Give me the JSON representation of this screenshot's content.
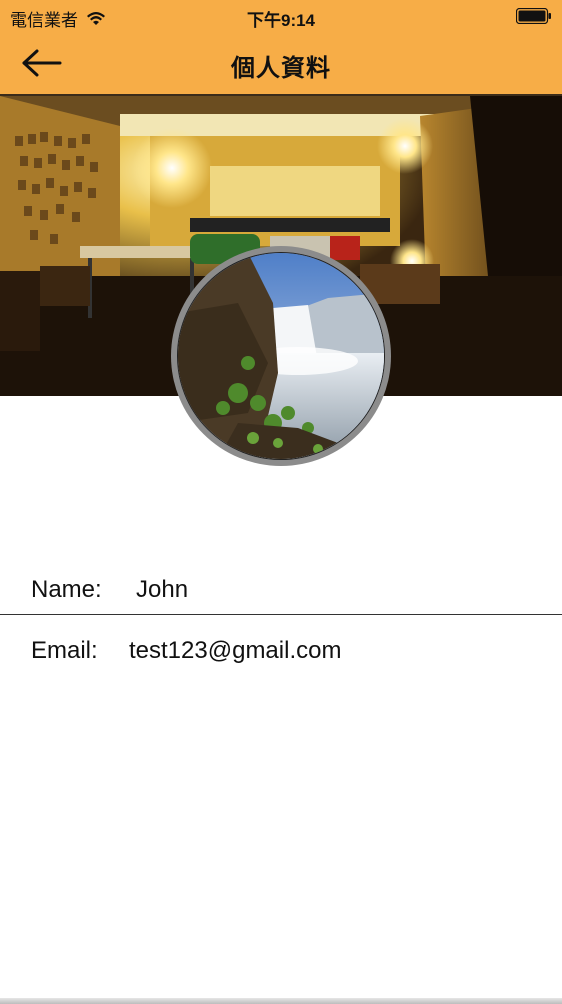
{
  "status_bar": {
    "carrier": "電信業者",
    "time": "下午9:14"
  },
  "nav": {
    "title": "個人資料",
    "back_icon": "back-arrow-icon"
  },
  "profile": {
    "name_label": "Name:",
    "name_value": "John",
    "email_label": "Email:",
    "email_value": "test123@gmail.com"
  },
  "colors": {
    "accent": "#f7ad47"
  }
}
